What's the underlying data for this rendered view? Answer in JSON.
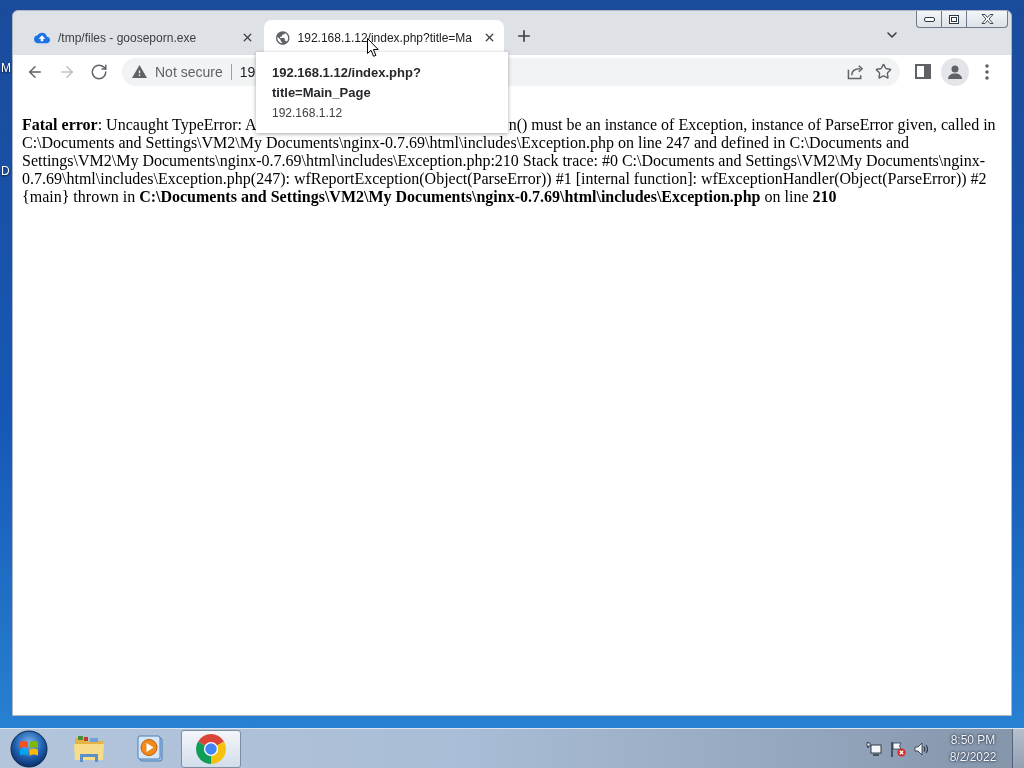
{
  "desktop": {
    "labels": [
      "M",
      "D"
    ]
  },
  "browser": {
    "tabs": [
      {
        "title": "/tmp/files - gooseporn.exe",
        "kind": "cloud",
        "selected": false
      },
      {
        "title": "192.168.1.12/index.php?title=Ma",
        "kind": "globe",
        "selected": true
      }
    ],
    "toolbar": {
      "nav": [
        {
          "kind": "back",
          "disabled": false
        },
        {
          "kind": "forward",
          "disabled": true
        },
        {
          "kind": "reload",
          "disabled": false
        }
      ],
      "omnibox": {
        "security": "Not secure",
        "url": "19"
      }
    },
    "tooltip": {
      "title_lines": [
        "192.168.1.12/index.php?",
        "title=Main_Page"
      ],
      "host": "192.168.1.12"
    },
    "page": {
      "error_before": "**Fatal error**: Uncaught TypeError: A",
      "error_after": "n() must be an instance of Exception, instance of ParseError given, called in C:\\Documents and Settings\\VM2\\My Documents\\nginx-0.7.69\\html\\includes\\Exception.php on line 247 and defined in C:\\Documents and Settings\\VM2\\My Documents\\nginx-0.7.69\\html\\includes\\Exception.php:210 Stack trace: #0 C:\\Documents and Settings\\VM2\\My Documents\\nginx-0.7.69\\html\\includes\\Exception.php(247): wfReportException(Object(ParseError)) #1 [internal function]: wfExceptionHandler(Object(ParseError)) #2 {main} thrown in **C:\\Documents and Settings\\VM2\\My Documents\\nginx-0.7.69\\html\\includes\\Exception.php** on line **210**"
    }
  },
  "taskbar": {
    "apps": [
      {
        "kind": "folder",
        "selected": false
      },
      {
        "kind": "media",
        "selected": false
      },
      {
        "kind": "browser",
        "selected": true
      }
    ],
    "clock": {
      "time": "8:50 PM",
      "date": "8/2/2022"
    }
  }
}
